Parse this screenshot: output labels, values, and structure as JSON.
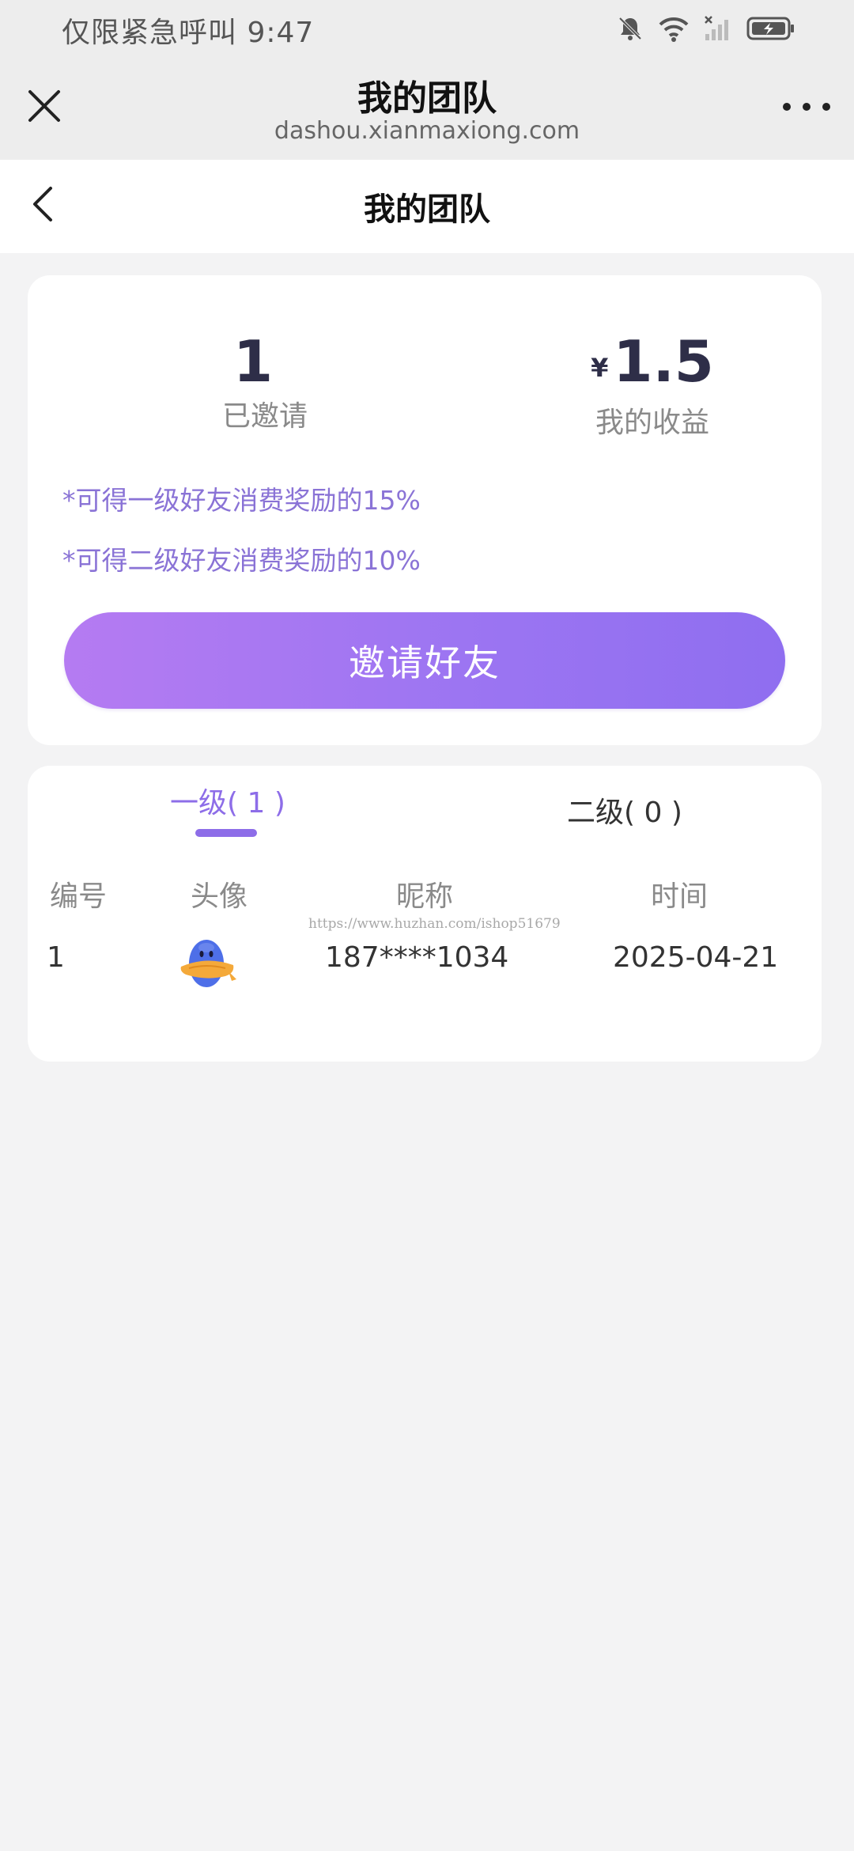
{
  "status_bar": {
    "text": "仅限紧急呼叫 9:47"
  },
  "browser": {
    "title": "我的团队",
    "url": "dashou.xianmaxiong.com"
  },
  "page": {
    "title": "我的团队"
  },
  "stats": {
    "invited_value": "1",
    "invited_label": "已邀请",
    "currency": "¥",
    "earnings_value": "1.5",
    "earnings_label": "我的收益",
    "note_level1": "*可得一级好友消费奖励的15%",
    "note_level2": "*可得二级好友消费奖励的10%",
    "invite_button": "邀请好友"
  },
  "team": {
    "tabs": [
      {
        "label": "一级( 1 )"
      },
      {
        "label": "二级( 0 )"
      }
    ],
    "columns": [
      "编号",
      "头像",
      "昵称",
      "时间"
    ],
    "watermark": "https://www.huzhan.com/ishop51679",
    "rows": [
      {
        "no": "1",
        "nickname": "187****1034",
        "time": "2025-04-21"
      }
    ]
  },
  "colors": {
    "accent": "#8d6de8",
    "button_gradient_start": "#b57bf2",
    "button_gradient_end": "#8f6ef0",
    "background": "#f3f3f4"
  }
}
